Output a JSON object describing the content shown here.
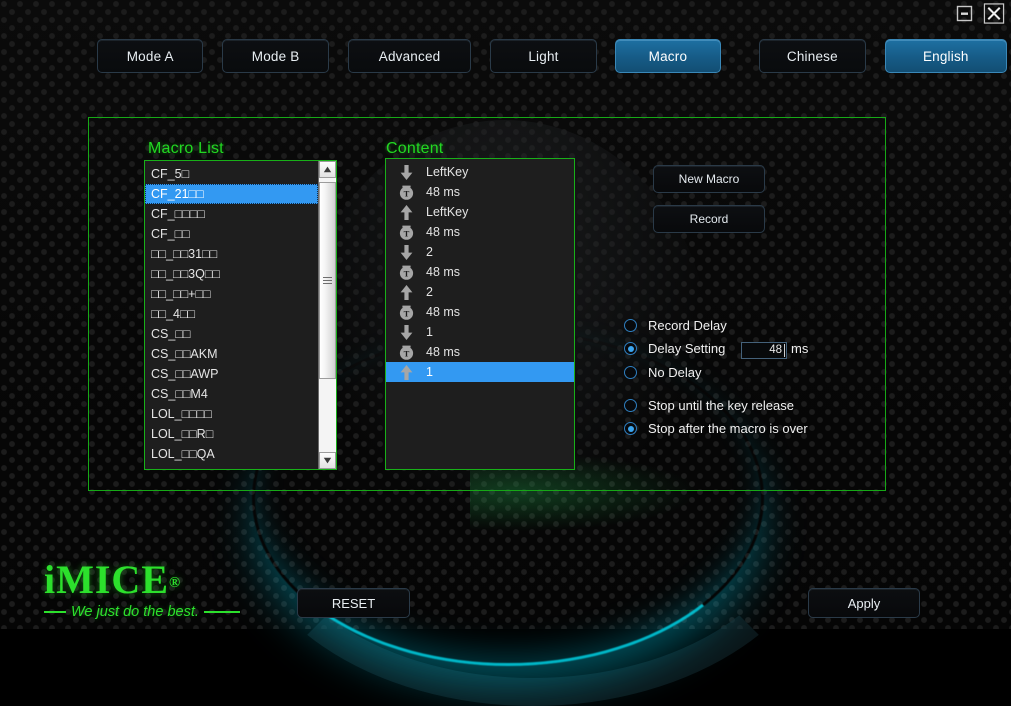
{
  "window": {
    "minimize_icon": "minimize-icon",
    "close_icon": "close-icon"
  },
  "tabs": [
    {
      "label": "Mode A",
      "active": false
    },
    {
      "label": "Mode B",
      "active": false
    },
    {
      "label": "Advanced",
      "active": false
    },
    {
      "label": "Light",
      "active": false
    },
    {
      "label": "Macro",
      "active": true
    },
    {
      "label": "Chinese",
      "active": false
    },
    {
      "label": "English",
      "active": true
    }
  ],
  "macro_panel": {
    "title": "Macro List",
    "items": [
      {
        "label": "CF_5□",
        "selected": false
      },
      {
        "label": "CF_21□□",
        "selected": true
      },
      {
        "label": "CF_□□□□",
        "selected": false
      },
      {
        "label": "CF_□□",
        "selected": false
      },
      {
        "label": "□□_□□31□□",
        "selected": false
      },
      {
        "label": "□□_□□3Q□□",
        "selected": false
      },
      {
        "label": "□□_□□+□□",
        "selected": false
      },
      {
        "label": "□□_4□□",
        "selected": false
      },
      {
        "label": "CS_□□",
        "selected": false
      },
      {
        "label": "CS_□□AKM",
        "selected": false
      },
      {
        "label": "CS_□□AWP",
        "selected": false
      },
      {
        "label": "CS_□□M4",
        "selected": false
      },
      {
        "label": "LOL_□□□□",
        "selected": false
      },
      {
        "label": "LOL_□□R□",
        "selected": false
      },
      {
        "label": "LOL_□□QA",
        "selected": false
      }
    ],
    "scrollbar": {
      "up_icon": "scroll-up-arrow-icon",
      "down_icon": "scroll-down-arrow-icon",
      "thumb_icon": "scrollbar-thumb"
    }
  },
  "content_panel": {
    "title": "Content",
    "items": [
      {
        "icon": "key-down-arrow-icon",
        "label": "LeftKey",
        "selected": false
      },
      {
        "icon": "delay-timer-icon",
        "label": "48 ms",
        "selected": false
      },
      {
        "icon": "key-up-arrow-icon",
        "label": "LeftKey",
        "selected": false
      },
      {
        "icon": "delay-timer-icon",
        "label": "48 ms",
        "selected": false
      },
      {
        "icon": "key-down-arrow-icon",
        "label": "2",
        "selected": false
      },
      {
        "icon": "delay-timer-icon",
        "label": "48 ms",
        "selected": false
      },
      {
        "icon": "key-up-arrow-icon",
        "label": "2",
        "selected": false
      },
      {
        "icon": "delay-timer-icon",
        "label": "48 ms",
        "selected": false
      },
      {
        "icon": "key-down-arrow-icon",
        "label": "1",
        "selected": false
      },
      {
        "icon": "delay-timer-icon",
        "label": "48 ms",
        "selected": false
      },
      {
        "icon": "key-up-arrow-icon",
        "label": "1",
        "selected": true
      }
    ]
  },
  "actions": {
    "new_macro_label": "New Macro",
    "record_label": "Record"
  },
  "delay_options": {
    "record_delay": {
      "label": "Record Delay",
      "selected": false
    },
    "delay_setting": {
      "label": "Delay Setting",
      "selected": true
    },
    "no_delay": {
      "label": "No Delay",
      "selected": false
    },
    "delay_value": "48",
    "delay_unit": "ms"
  },
  "stop_options": {
    "stop_until_release": {
      "label": "Stop until the key release",
      "selected": false
    },
    "stop_after_macro": {
      "label": "Stop after the macro is over",
      "selected": true
    }
  },
  "branding": {
    "logo_text": "iMICE",
    "logo_registered": "®",
    "tagline": "We just do the best."
  },
  "footer": {
    "reset_label": "RESET",
    "apply_label": "Apply"
  },
  "colors": {
    "frame_green": "#16a816",
    "title_green": "#22d822",
    "accent_blue": "#3399f2",
    "tab_active_blue": "#1e70a2",
    "glow_cyan": "#00d7eb"
  }
}
